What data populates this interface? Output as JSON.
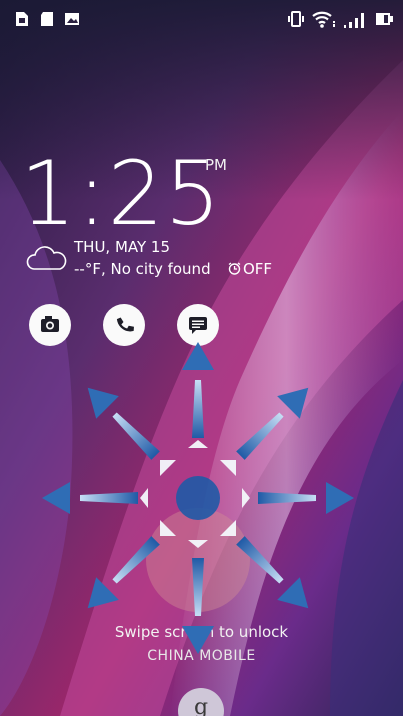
{
  "status_bar": {
    "left_icons": [
      "sim-card-icon",
      "sd-card-icon",
      "image-icon"
    ],
    "right_icons": [
      "vibrate-icon",
      "wifi-icon",
      "signal-icon",
      "battery-icon"
    ]
  },
  "clock": {
    "time": "1:25",
    "ampm": "PM"
  },
  "weather": {
    "icon": "cloud-icon",
    "date": "THU, MAY 15",
    "condition": "--°F, No city found",
    "alarm": "OFF"
  },
  "shortcuts": [
    {
      "name": "camera",
      "icon": "camera-icon"
    },
    {
      "name": "phone",
      "icon": "phone-icon"
    },
    {
      "name": "messages",
      "icon": "message-icon"
    }
  ],
  "lock": {
    "hint": "Swipe screen to unlock",
    "carrier": "CHINA  MOBILE"
  },
  "colors": {
    "arrow": "#2f6db5",
    "arrow_light": "#9cc3ea",
    "center_dot": "#1f5aa6"
  }
}
